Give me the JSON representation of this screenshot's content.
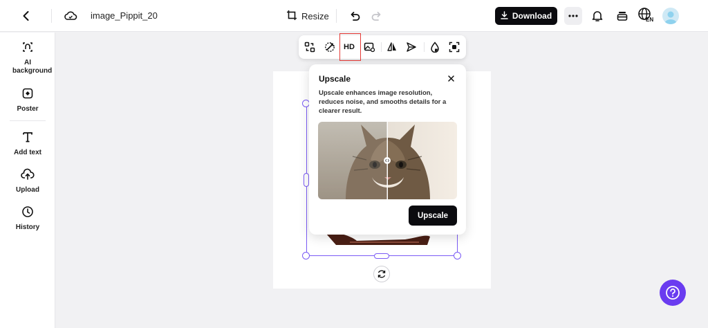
{
  "header": {
    "file_name": "image_Pippit_20",
    "resize_label": "Resize",
    "download_label": "Download",
    "language_code": "EN"
  },
  "sidebar": {
    "items": [
      {
        "label": "AI background",
        "icon": "ai-background-icon"
      },
      {
        "label": "Poster",
        "icon": "poster-icon"
      },
      {
        "label": "Add text",
        "icon": "text-icon"
      },
      {
        "label": "Upload",
        "icon": "cloud-upload-icon"
      },
      {
        "label": "History",
        "icon": "clock-icon"
      }
    ]
  },
  "toolbar": {
    "hd_label": "HD",
    "tools": [
      "replace-icon",
      "magic-eraser-icon",
      "hd-icon",
      "image-background-icon",
      "flip-icon",
      "send-icon",
      "opacity-icon",
      "focus-icon"
    ]
  },
  "popover": {
    "title": "Upscale",
    "description": "Upscale enhances image resolution, reduces noise, and smooths details for a clearer result.",
    "button_label": "Upscale"
  },
  "colors": {
    "accent": "#7a5af5",
    "help": "#6a3cf0",
    "highlight": "#e53935",
    "primary_button": "#0b0b0f"
  }
}
